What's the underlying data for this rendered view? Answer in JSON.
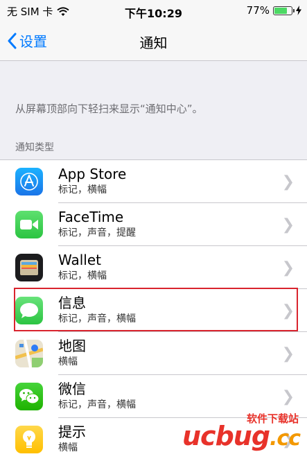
{
  "status": {
    "carrier": "无 SIM 卡",
    "time": "下午10:29",
    "battery_percent": "77%",
    "battery_level": 0.77
  },
  "nav": {
    "back_label": "设置",
    "title": "通知"
  },
  "description": "从屏幕顶部向下轻扫来显示“通知中心”。",
  "section_header": "通知类型",
  "apps": [
    {
      "name": "App Store",
      "subtitle": "标记，横幅",
      "icon": "app-store-icon",
      "color": "#1a8cf0"
    },
    {
      "name": "FaceTime",
      "subtitle": "标记，声音，提醒",
      "icon": "facetime-icon",
      "color": "#3ad051"
    },
    {
      "name": "Wallet",
      "subtitle": "标记，横幅",
      "icon": "wallet-icon",
      "color": "#1c1c1e"
    },
    {
      "name": "信息",
      "subtitle": "标记，声音，横幅",
      "icon": "messages-icon",
      "color": "#3ad051"
    },
    {
      "name": "地图",
      "subtitle": "横幅",
      "icon": "maps-icon",
      "color": "#e9e4d8"
    },
    {
      "name": "微信",
      "subtitle": "标记，声音，横幅",
      "icon": "wechat-icon",
      "color": "#2dc100"
    },
    {
      "name": "提示",
      "subtitle": "横幅",
      "icon": "tips-icon",
      "color": "#ffcc00"
    }
  ],
  "watermark": {
    "top": "软件下载站",
    "brand": "ucbug",
    "suffix": ".cc"
  },
  "colors": {
    "accent": "#007aff",
    "highlight_border": "#d9232d"
  }
}
